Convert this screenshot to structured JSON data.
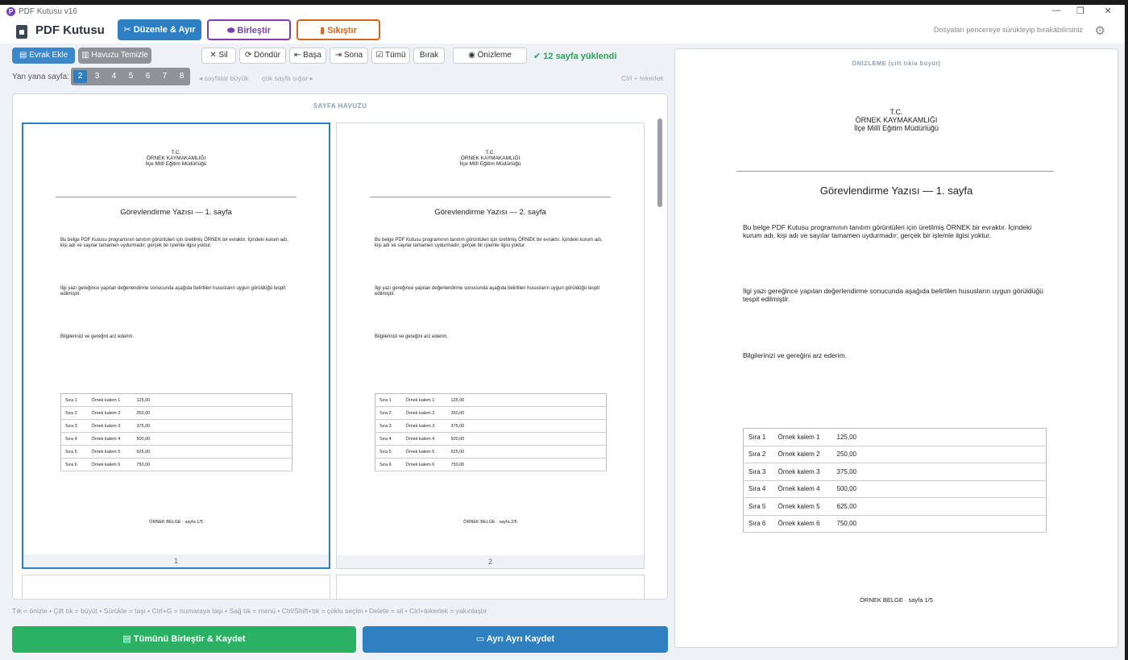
{
  "window": {
    "title": "PDF Kutusu v16",
    "badge": "P",
    "minimize": "—",
    "restore": "❐",
    "close": "✕"
  },
  "header": {
    "app_name": "PDF Kutusu",
    "tabs": [
      {
        "label": "✂  Düzenle & Ayır"
      },
      {
        "label": "⬬  Birleştir"
      },
      {
        "label": "▮  Sıkıştır"
      }
    ],
    "drop_hint": "Dosyaları pencereye sürükleyip bırakabilirsiniz",
    "settings_glyph": "⚙"
  },
  "toolbar": {
    "add_doc": "▤ Evrak Ekle",
    "clear_pool": "▥ Havuzu Temizle",
    "delete": "✕ Sil",
    "rotate": "⟳ Döndür",
    "to_start": "⇤ Başa",
    "to_end": "⇥ Sona",
    "select_all": "☑ Tümü",
    "deselect": "Bırak",
    "preview": "◉ Önizleme",
    "loaded_status": "✔  12 sayfa yüklendi"
  },
  "columns": {
    "label": "Yan yana sayfa:",
    "options": [
      "2",
      "3",
      "4",
      "5",
      "6",
      "7",
      "8"
    ],
    "selected": "2",
    "hint_big": "◂ sayfalar büyük",
    "hint_small": "çok sayfa sığar ▸",
    "hint_ctrl": "Ctrl + tekerlek"
  },
  "pool": {
    "title": "SAYFA HAVUZU"
  },
  "document": {
    "header_lines": [
      "T.C.",
      "ÖRNEK KAYMAKAMLIĞI",
      "İlçe Millî Eğitim Müdürlüğü"
    ],
    "para1": "Bu belge PDF Kutusu programının tanıtım görüntüleri için üretilmiş ÖRNEK bir evraktır. İçindeki kurum adı, kişi adı ve sayılar tamamen uydurmadır; gerçek bir işlemle ilgisi yoktur.",
    "para2": "İlgi yazı gereğince yapılan değerlendirme sonucunda aşağıda belirtilen hususların uygun görüldüğü tespit edilmiştir.",
    "para3": "Bilgilerinizi ve gereğini arz ederim.",
    "table": [
      [
        "Sıra 1",
        "Örnek kalem 1",
        "125,00"
      ],
      [
        "Sıra 2",
        "Örnek kalem 2",
        "250,00"
      ],
      [
        "Sıra 3",
        "Örnek kalem 3",
        "375,00"
      ],
      [
        "Sıra 4",
        "Örnek kalem 4",
        "500,00"
      ],
      [
        "Sıra 5",
        "Örnek kalem 5",
        "625,00"
      ],
      [
        "Sıra 6",
        "Örnek kalem 6",
        "750,00"
      ]
    ]
  },
  "pages": [
    {
      "number": "1",
      "title": "Görevlendirme Yazısı — 1. sayfa",
      "footer": "ÖRNEK BELGE · sayfa 1/5"
    },
    {
      "number": "2",
      "title": "Görevlendirme Yazısı — 2. sayfa",
      "footer": "ÖRNEK BELGE · sayfa 2/5"
    }
  ],
  "preview": {
    "label": "ÖNİZLEME  (çift tıkla büyüt)",
    "title": "Görevlendirme Yazısı — 1. sayfa",
    "footer": "ÖRNEK BELGE · sayfa 1/5"
  },
  "hints": {
    "shortcuts": "Tık = önizle   •   Çift tık = büyüt   •   Sürükle = taşı   •   Ctrl+G = numaraya taşı   •   Sağ tık = menü   •   Ctrl/Shift+tık = çoklu seçim   •   Delete = sil   •   Ctrl+tekerlek = yakınlaştır"
  },
  "actions": {
    "merge_save": "▤  Tümünü Birleştir & Kaydet",
    "separate_save": "▭  Ayrı Ayrı Kaydet"
  },
  "colors": {
    "primary": "#2d7fc1",
    "merge_purple": "#7b3fb0",
    "compress_orange": "#d9651a",
    "success_green": "#2aa55a",
    "merge_button": "#2bb163",
    "save_button": "#2f80c1"
  }
}
